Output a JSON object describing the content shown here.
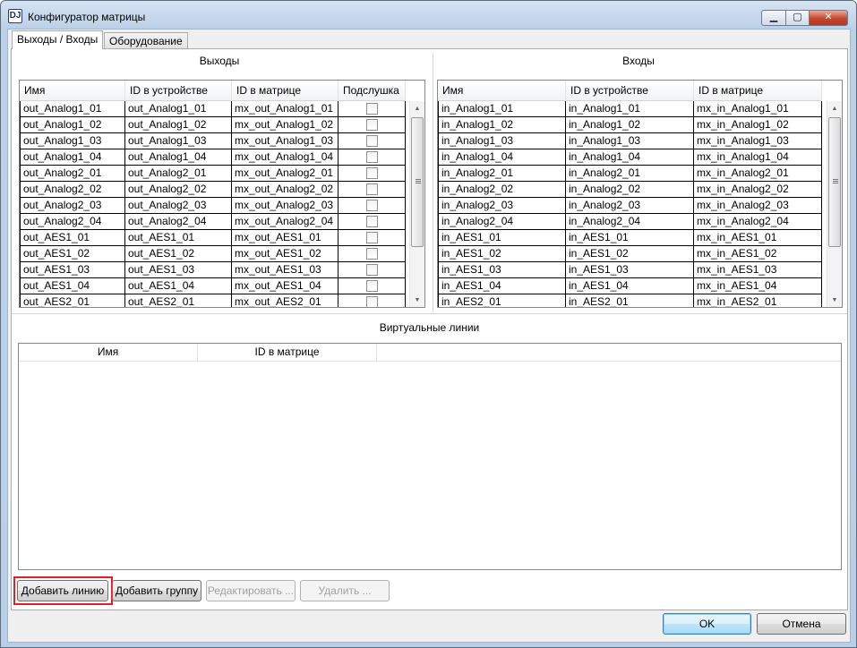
{
  "window": {
    "title": "Конфигуратор матрицы",
    "icon_text": "DJ",
    "minimize": "▁",
    "maximize": "▢",
    "close": "✕"
  },
  "tabs": [
    {
      "label": "Выходы / Входы",
      "active": true
    },
    {
      "label": "Оборудование",
      "active": false
    }
  ],
  "outputs": {
    "title": "Выходы",
    "columns": [
      "Имя",
      "ID в устройстве",
      "ID в матрице",
      "Подслушка"
    ],
    "rows": [
      [
        "out_Analog1_01",
        "out_Analog1_01",
        "mx_out_Analog1_01"
      ],
      [
        "out_Analog1_02",
        "out_Analog1_02",
        "mx_out_Analog1_02"
      ],
      [
        "out_Analog1_03",
        "out_Analog1_03",
        "mx_out_Analog1_03"
      ],
      [
        "out_Analog1_04",
        "out_Analog1_04",
        "mx_out_Analog1_04"
      ],
      [
        "out_Analog2_01",
        "out_Analog2_01",
        "mx_out_Analog2_01"
      ],
      [
        "out_Analog2_02",
        "out_Analog2_02",
        "mx_out_Analog2_02"
      ],
      [
        "out_Analog2_03",
        "out_Analog2_03",
        "mx_out_Analog2_03"
      ],
      [
        "out_Analog2_04",
        "out_Analog2_04",
        "mx_out_Analog2_04"
      ],
      [
        "out_AES1_01",
        "out_AES1_01",
        "mx_out_AES1_01"
      ],
      [
        "out_AES1_02",
        "out_AES1_02",
        "mx_out_AES1_02"
      ],
      [
        "out_AES1_03",
        "out_AES1_03",
        "mx_out_AES1_03"
      ],
      [
        "out_AES1_04",
        "out_AES1_04",
        "mx_out_AES1_04"
      ],
      [
        "out_AES2_01",
        "out_AES2_01",
        "mx_out_AES2_01"
      ]
    ]
  },
  "inputs": {
    "title": "Входы",
    "columns": [
      "Имя",
      "ID в устройстве",
      "ID в матрице"
    ],
    "rows": [
      [
        "in_Analog1_01",
        "in_Analog1_01",
        "mx_in_Analog1_01"
      ],
      [
        "in_Analog1_02",
        "in_Analog1_02",
        "mx_in_Analog1_02"
      ],
      [
        "in_Analog1_03",
        "in_Analog1_03",
        "mx_in_Analog1_03"
      ],
      [
        "in_Analog1_04",
        "in_Analog1_04",
        "mx_in_Analog1_04"
      ],
      [
        "in_Analog2_01",
        "in_Analog2_01",
        "mx_in_Analog2_01"
      ],
      [
        "in_Analog2_02",
        "in_Analog2_02",
        "mx_in_Analog2_02"
      ],
      [
        "in_Analog2_03",
        "in_Analog2_03",
        "mx_in_Analog2_03"
      ],
      [
        "in_Analog2_04",
        "in_Analog2_04",
        "mx_in_Analog2_04"
      ],
      [
        "in_AES1_01",
        "in_AES1_01",
        "mx_in_AES1_01"
      ],
      [
        "in_AES1_02",
        "in_AES1_02",
        "mx_in_AES1_02"
      ],
      [
        "in_AES1_03",
        "in_AES1_03",
        "mx_in_AES1_03"
      ],
      [
        "in_AES1_04",
        "in_AES1_04",
        "mx_in_AES1_04"
      ],
      [
        "in_AES2_01",
        "in_AES2_01",
        "mx_in_AES2_01"
      ]
    ]
  },
  "virtual_lines": {
    "title": "Виртуальные линии",
    "columns": [
      "Имя",
      "ID в матрице"
    ],
    "rows": []
  },
  "buttons": {
    "add_line": "Добавить линию",
    "add_group": "Добавить группу",
    "edit": "Редактировать ...",
    "delete": "Удалить ...",
    "ok": "OK",
    "cancel": "Отмена"
  },
  "scroll": {
    "up": "▲",
    "down": "▼"
  },
  "colors": {
    "highlight": "#e0202a",
    "title_gradient": "#bcd1e8"
  }
}
